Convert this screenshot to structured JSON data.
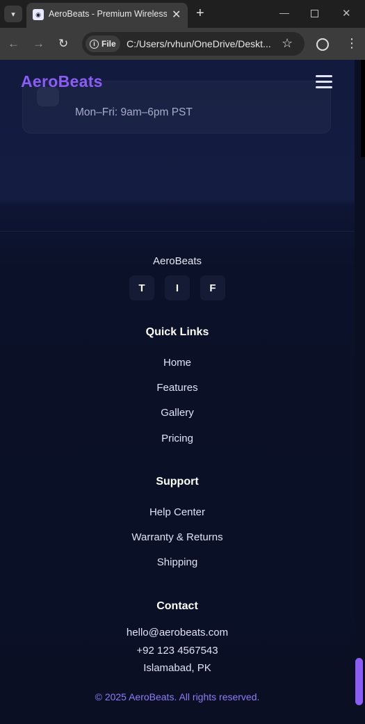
{
  "browser": {
    "tab_title": "AeroBeats - Premium Wireless Headphones",
    "url": "C:/Users/rvhun/OneDrive/Deskt...",
    "file_chip": "File",
    "new_tab": "+",
    "close": "✕"
  },
  "header": {
    "logo": "AeroBeats"
  },
  "contact_card": {
    "hours": "Mon–Fri: 9am–6pm PST"
  },
  "footer": {
    "brand": "AeroBeats",
    "socials": [
      "T",
      "I",
      "F"
    ],
    "quick_links": {
      "heading": "Quick Links",
      "items": [
        "Home",
        "Features",
        "Gallery",
        "Pricing"
      ]
    },
    "support": {
      "heading": "Support",
      "items": [
        "Help Center",
        "Warranty & Returns",
        "Shipping"
      ]
    },
    "contact": {
      "heading": "Contact",
      "email": "hello@aerobeats.com",
      "phone": "+92 123 4567543",
      "location": "Islamabad, PK"
    },
    "copyright": "© 2025 AeroBeats. All rights reserved."
  },
  "colors": {
    "accent": "#8b5cf6",
    "background": "#0b1024"
  }
}
